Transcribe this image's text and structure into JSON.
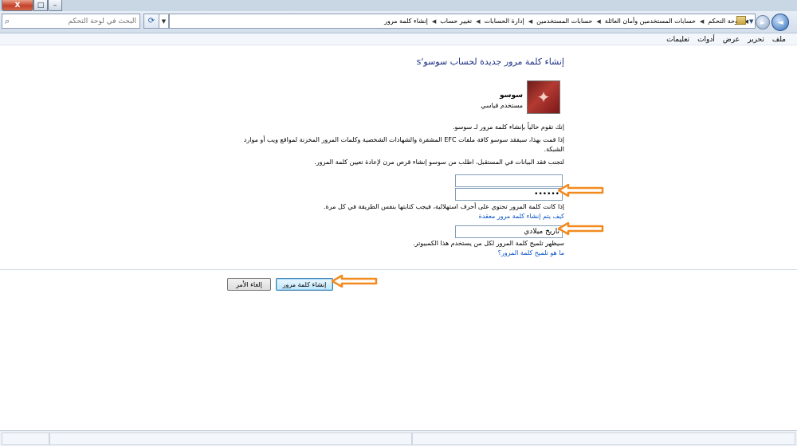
{
  "window": {
    "close_glyph": "X",
    "maximize_glyph": "□",
    "minimize_glyph": "–"
  },
  "navigation": {
    "search_placeholder": "البحث في لوحة التحكم",
    "breadcrumbs": [
      "لوحة التحكم",
      "حسابات المستخدمين وأمان العائلة",
      "حسابات المستخدمين",
      "إدارة الحسابات",
      "تغيير حساب",
      "إنشاء كلمة مرور"
    ]
  },
  "menu": {
    "items": [
      "ملف",
      "تحرير",
      "عرض",
      "أدوات",
      "تعليمات"
    ]
  },
  "page": {
    "title": "إنشاء كلمة مرور جديدة لحساب سوسو's",
    "user_name": "سوسو",
    "user_type": "مستخدم قياسي",
    "intro": "إنك تقوم حالياً بإنشاء كلمة مرور لـ سوسو.",
    "warning": "إذا قمت بهذا، سيفقد سوسو كافة ملفات EFC المشفرة والشهادات الشخصية وكلمات المرور المخزنة لمواقع ويب أو موارد الشبكة.",
    "advice": "لتجنب فقد البيانات في المستقبل، اطلب من سوسو إنشاء قرص مرن لإعادة تعيين كلمة المرور.",
    "new_password_value": "",
    "confirm_password_value": "••••••",
    "caps_note": "إذا كانت كلمة المرور تحتوي على أحرف استهلالية، فيجب كتابتها بنفس الطريقة في كل مرة.",
    "strong_link": "كيف يتم إنشاء كلمة مرور معقدة",
    "hint_value": "تاريخ ميلادي",
    "hint_note": "سيظهر تلميح كلمة المرور لكل من يستخدم هذا الكمبيوتر.",
    "hint_link": "ما هو تلميح كلمة المرور؟",
    "create_button": "إنشاء كلمة مرور",
    "cancel_button": "إلغاء الأمر"
  },
  "colors": {
    "title": "#1e3287",
    "link": "#0b54c6",
    "annotation_arrow": "#f28a1e"
  }
}
